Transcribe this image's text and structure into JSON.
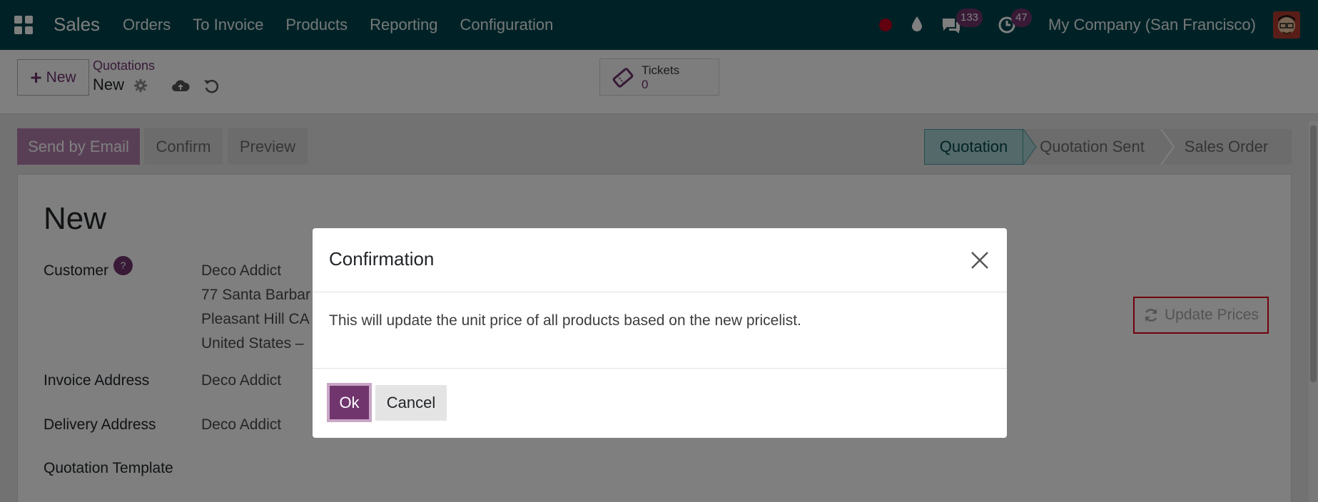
{
  "nav": {
    "app_name": "Sales",
    "menu": [
      "Orders",
      "To Invoice",
      "Products",
      "Reporting",
      "Configuration"
    ],
    "messages_count": "133",
    "activities_count": "47",
    "company": "My Company (San Francisco)"
  },
  "control": {
    "new_label": "New",
    "breadcrumb_parent": "Quotations",
    "breadcrumb_current": "New",
    "tickets_label": "Tickets",
    "tickets_count": "0"
  },
  "actions": {
    "send_email": "Send by Email",
    "confirm": "Confirm",
    "preview": "Preview"
  },
  "stages": [
    "Quotation",
    "Quotation Sent",
    "Sales Order"
  ],
  "form": {
    "title": "New",
    "customer_label": "Customer",
    "help_mark": "?",
    "customer_name": "Deco Addict",
    "address_line1": "77 Santa Barbar",
    "address_line2": "Pleasant Hill CA",
    "address_line3": "United States –",
    "invoice_label": "Invoice Address",
    "invoice_value": "Deco Addict",
    "delivery_label": "Delivery Address",
    "delivery_value": "Deco Addict",
    "template_label": "Quotation Template",
    "update_prices": "Update Prices"
  },
  "dialog": {
    "title": "Confirmation",
    "body": "This will update the unit price of all products based on the new pricelist.",
    "ok": "Ok",
    "cancel": "Cancel"
  },
  "colors": {
    "navbar": "#00444c",
    "brand": "#71356e",
    "highlight": "#e3001b"
  },
  "icons": [
    "apps-grid-icon",
    "record-icon",
    "drop-icon",
    "chat-icon",
    "clock-icon",
    "gear-icon",
    "cloud-upload-icon",
    "undo-icon",
    "ticket-icon",
    "refresh-icon",
    "close-icon"
  ]
}
